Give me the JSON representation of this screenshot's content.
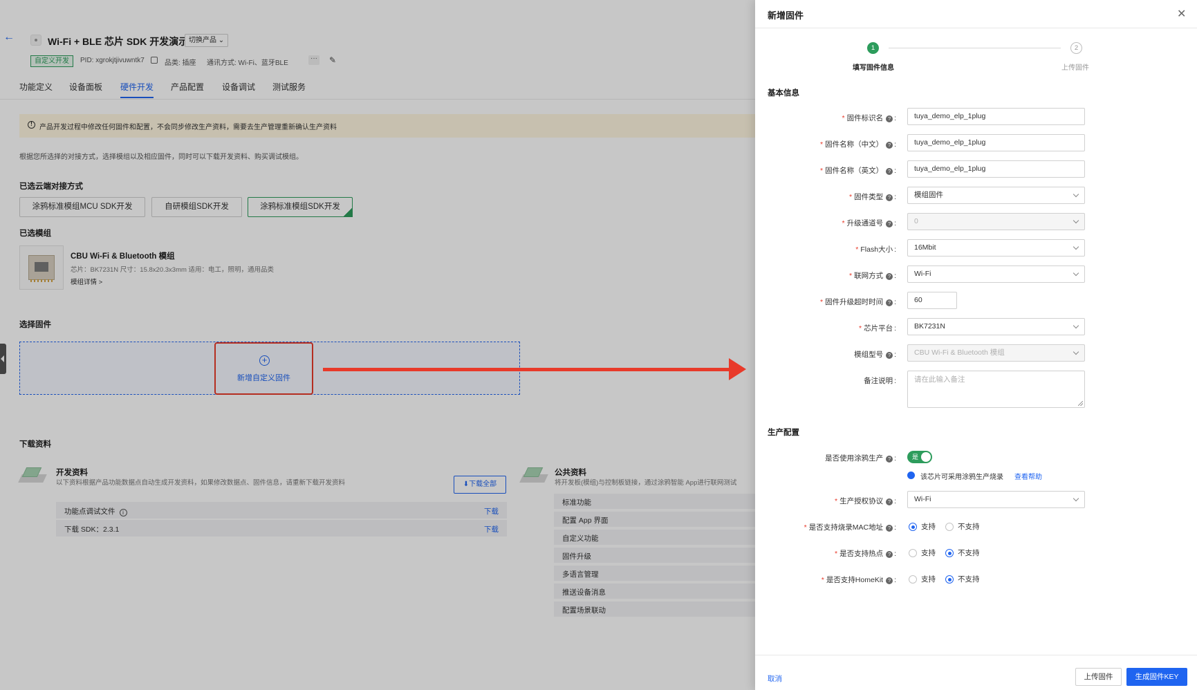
{
  "header": {
    "product_title": "Wi-Fi + BLE 芯片 SDK 开发演示",
    "switch_label": "切换产品",
    "custom_tag": "自定义开发",
    "pid": "PID: xgrokjtjivuwntk7",
    "category": "品类: 插座",
    "protocol": "通讯方式: Wi-Fi、蓝牙BLE",
    "more": "···"
  },
  "tabs": [
    "功能定义",
    "设备面板",
    "硬件开发",
    "产品配置",
    "设备调试",
    "测试服务"
  ],
  "warning": "产品开发过程中修改任何固件和配置，不会同步修改生产资料，需要去生产管理重新确认生产资料",
  "intro": "根据您所选择的对接方式，选择模组以及相应固件，同时可以下载开发资料、购买调试模组。",
  "cloud": {
    "title": "已选云端对接方式",
    "options": [
      "涂鸦标准模组MCU SDK开发",
      "自研模组SDK开发",
      "涂鸦标准模组SDK开发"
    ]
  },
  "module": {
    "section_title": "已选模组",
    "name": "CBU Wi-Fi & Bluetooth 模组",
    "spec": "芯片：BK7231N   尺寸：15.8x20.3x3mm   适用：电工，照明，通用品类",
    "detail_link": "模组详情 >"
  },
  "firmware": {
    "section_title": "选择固件",
    "add_label": "新增自定义固件"
  },
  "downloads": {
    "section_title": "下载资料",
    "dev_title": "开发资料",
    "dev_desc": "以下资料根据产品功能数据点自动生成开发资料，如果修改数据点、固件信息，请重新下载开发资料",
    "download_all": "⬇下载全部",
    "rows": [
      {
        "label": "功能点调试文件",
        "link": "下载"
      },
      {
        "label": "下载 SDK：2.3.1",
        "link": "下载"
      }
    ],
    "public_title": "公共资料",
    "public_desc": "将开发板(模组)与控制板链接，通过涂鸦智能 App进行联网测试",
    "public_rows": [
      "标准功能",
      "配置 App 界面",
      "自定义功能",
      "固件升级",
      "多语言管理",
      "推送设备消息",
      "配置场景联动"
    ]
  },
  "drawer": {
    "title": "新增固件",
    "close": "✕",
    "steps": [
      {
        "num": "1",
        "label": "填写固件信息"
      },
      {
        "num": "2",
        "label": "上传固件"
      }
    ],
    "basic_title": "基本信息",
    "fields": [
      {
        "label": "固件标识名",
        "required": true,
        "help": true,
        "value": "tuya_demo_elp_1plug"
      },
      {
        "label": "固件名称（中文）",
        "required": true,
        "help": true,
        "value": "tuya_demo_elp_1plug"
      },
      {
        "label": "固件名称（英文）",
        "required": true,
        "help": true,
        "value": "tuya_demo_elp_1plug"
      },
      {
        "label": "固件类型",
        "required": true,
        "help": true,
        "value": "模组固件"
      },
      {
        "label": "升级通道号",
        "required": true,
        "help": true,
        "value": "0"
      },
      {
        "label": "Flash大小",
        "required": true,
        "help": false,
        "value": "16Mbit"
      },
      {
        "label": "联网方式",
        "required": true,
        "help": true,
        "value": "Wi-Fi"
      },
      {
        "label": "固件升级超时时间",
        "required": true,
        "help": true,
        "value": "60"
      },
      {
        "label": "芯片平台",
        "required": true,
        "help": false,
        "value": "BK7231N"
      },
      {
        "label": "模组型号",
        "required": false,
        "help": true,
        "value": "CBU Wi-Fi & Bluetooth 模组"
      },
      {
        "label": "备注说明",
        "required": false,
        "help": false,
        "value": "请在此输入备注"
      }
    ],
    "prod_title": "生产配置",
    "prod": {
      "use_tuya_label": "是否使用涂鸦生产",
      "toggle_text": "是",
      "note": "该芯片可采用涂鸦生产烧录",
      "note_link": "查看帮助",
      "auth_label": "生产授权协议",
      "auth_value": "Wi-Fi",
      "mac_label": "是否支持烧录MAC地址",
      "hotspot_label": "是否支持热点",
      "homekit_label": "是否支持HomeKit",
      "support": "支持",
      "not_support": "不支持"
    },
    "footer": {
      "cancel": "取消",
      "upload": "上传固件",
      "generate": "生成固件KEY"
    }
  },
  "colors": {
    "primary": "#1f64f0",
    "green": "#2d9c5c",
    "red_annotation": "#e83a2a",
    "warning_bg": "#fff7e0"
  }
}
